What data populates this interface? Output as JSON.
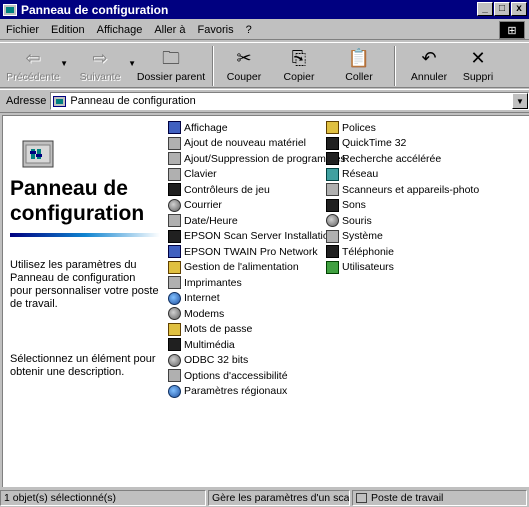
{
  "window": {
    "title": "Panneau de configuration",
    "buttons": [
      "_",
      "□",
      "x"
    ]
  },
  "menu": [
    {
      "label": "Fichier"
    },
    {
      "label": "Edition"
    },
    {
      "label": "Affichage"
    },
    {
      "label": "Aller à"
    },
    {
      "label": "Favoris"
    },
    {
      "label": "?"
    }
  ],
  "toolbar": {
    "back": "Précédente",
    "forward": "Suivante",
    "up": "Dossier parent",
    "cut": "Couper",
    "copy": "Copier",
    "paste": "Coller",
    "undo": "Annuler",
    "delete": "Suppri"
  },
  "address": {
    "label": "Adresse",
    "value": "Panneau de configuration"
  },
  "left_pane": {
    "heading_line1": "Panneau de",
    "heading_line2": "configuration",
    "description": "Utilisez les paramètres du Panneau de configuration pour personnaliser votre poste de travail.",
    "hint": "Sélectionnez un élément pour obtenir une description."
  },
  "items_col1": [
    "Affichage",
    "Ajout de nouveau matériel",
    "Ajout/Suppression de programmes",
    "Clavier",
    "Contrôleurs de jeu",
    "Courrier",
    "Date/Heure",
    "EPSON Scan Server Installation",
    "EPSON TWAIN Pro Network",
    "Gestion de l'alimentation",
    "Imprimantes",
    "Internet",
    "Modems",
    "Mots de passe",
    "Multimédia",
    "ODBC 32 bits",
    "Options d'accessibilité",
    "Paramètres régionaux"
  ],
  "items_col2": [
    "Polices",
    "QuickTime 32",
    "Recherche accélérée",
    "Réseau",
    "Scanneurs et appareils-photo",
    "Sons",
    "Souris",
    "Système",
    "Téléphonie",
    "Utilisateurs"
  ],
  "status": {
    "selection": "1 objet(s) sélectionné(s)",
    "info": "Gère les paramètres d'un scanneur",
    "location": "Poste de travail"
  }
}
